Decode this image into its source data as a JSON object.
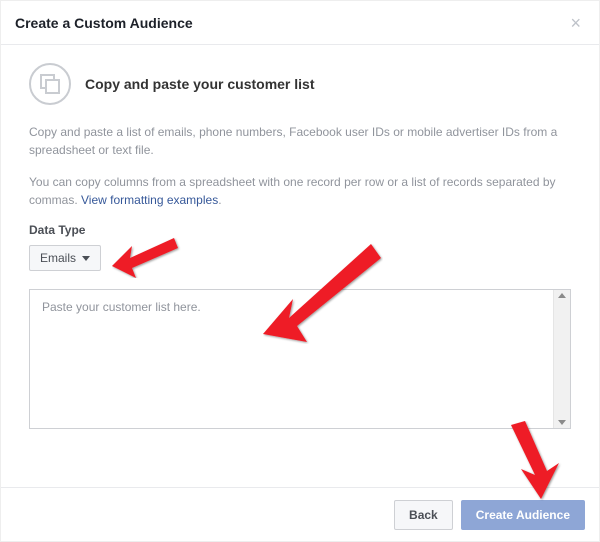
{
  "dialog": {
    "title": "Create a Custom Audience",
    "close": "×"
  },
  "section": {
    "heading": "Copy and paste your customer list",
    "desc1": "Copy and paste a list of emails, phone numbers, Facebook user IDs or mobile advertiser IDs from a spreadsheet or text file.",
    "desc2_prefix": "You can copy columns from a spreadsheet with one record per row or a list of records separated by commas. ",
    "desc2_link": "View formatting examples",
    "desc2_suffix": "."
  },
  "form": {
    "data_type_label": "Data Type",
    "data_type_value": "Emails",
    "paste_placeholder": "Paste your customer list here."
  },
  "footer": {
    "back": "Back",
    "create": "Create Audience"
  }
}
